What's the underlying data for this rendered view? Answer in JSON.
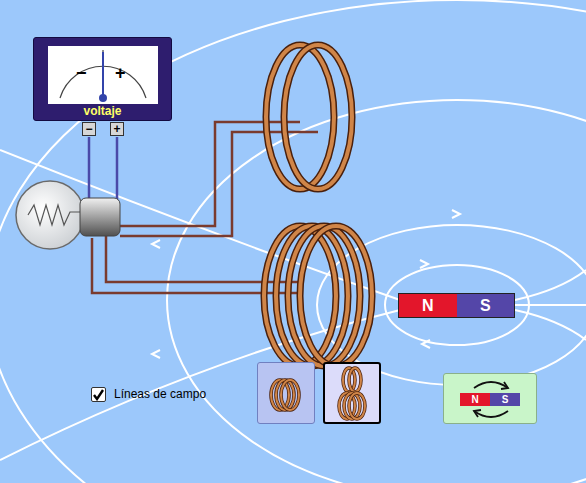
{
  "voltmeter": {
    "label": "voltaje",
    "scale_minus": "−",
    "scale_plus": "+",
    "terminal_minus": "−",
    "terminal_plus": "+",
    "level": 0.5
  },
  "magnet": {
    "north": "N",
    "south": "S"
  },
  "field_lines": {
    "label": "Líneas de campo",
    "checked": true
  },
  "coil_options": [
    {
      "kind": "one-coil",
      "selected": false
    },
    {
      "kind": "two-coils",
      "selected": true
    }
  ],
  "flip_button": {
    "north": "N",
    "south": "S"
  }
}
